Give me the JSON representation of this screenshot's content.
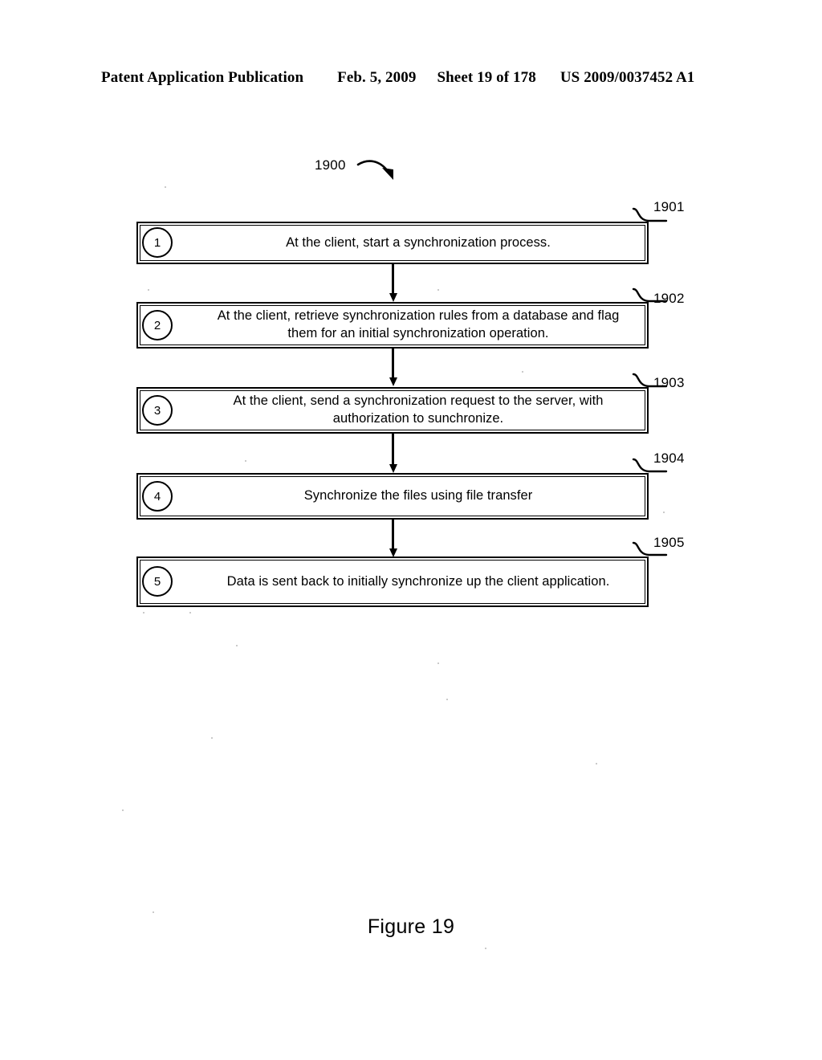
{
  "header": {
    "title": "Patent Application Publication",
    "date": "Feb. 5, 2009",
    "sheet": "Sheet 19 of 178",
    "doc_number": "US 2009/0037452 A1"
  },
  "figure": {
    "caption": "Figure 19",
    "diagram_label": "1900",
    "steps": [
      {
        "number": "1",
        "ref": "1901",
        "text": "At the client, start a synchronization process."
      },
      {
        "number": "2",
        "ref": "1902",
        "text": "At the client, retrieve synchronization rules from a database and flag them for an initial synchronization operation."
      },
      {
        "number": "3",
        "ref": "1903",
        "text": "At the client, send a synchronization request to the server, with authorization to sunchronize."
      },
      {
        "number": "4",
        "ref": "1904",
        "text": "Synchronize the files using file transfer"
      },
      {
        "number": "5",
        "ref": "1905",
        "text": "Data is sent back to initially synchronize up the client application."
      }
    ]
  },
  "colors": {
    "ink": "#000000",
    "paper": "#ffffff"
  }
}
